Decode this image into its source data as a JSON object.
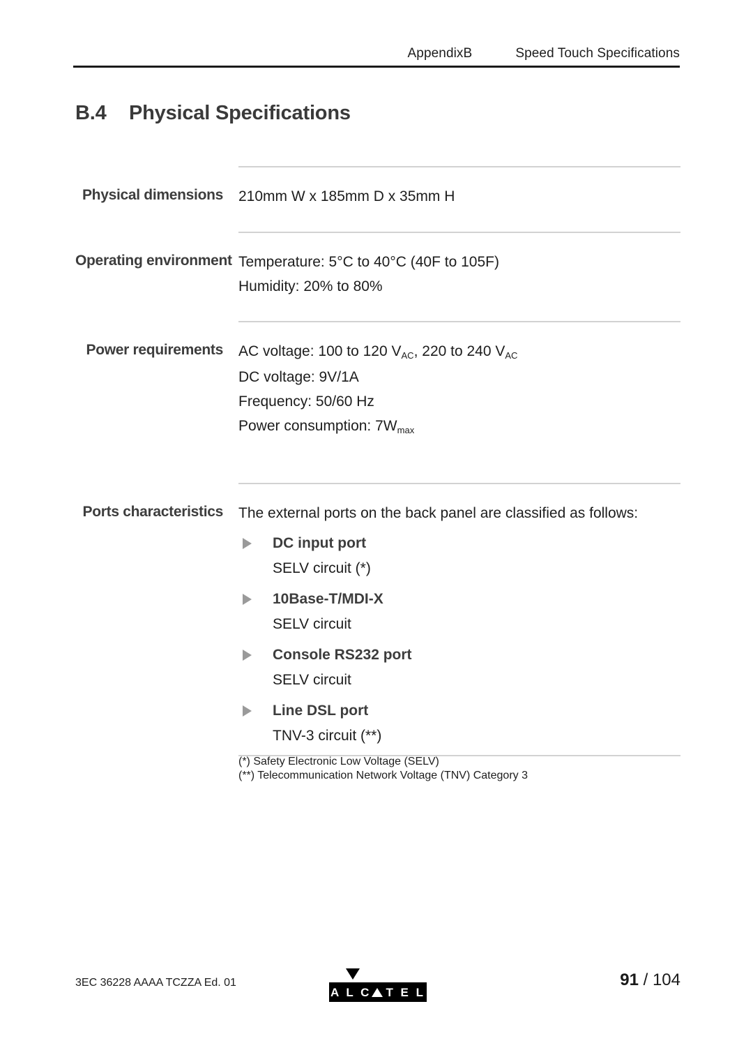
{
  "header": {
    "appendix": "AppendixB",
    "doc_title": "Speed Touch Specifications"
  },
  "section": {
    "number": "B.4",
    "title": "Physical Specifications"
  },
  "spec_table": {
    "rows": [
      {
        "label": "Physical dimensions",
        "lines": [
          "210mm W x 185mm D x 35mm H"
        ]
      },
      {
        "label": "Operating environment",
        "lines": [
          "Temperature: 5°C to 40°C (40F to 105F)",
          "Humidity: 20% to 80%"
        ]
      },
      {
        "label": "Power requirements",
        "lines": [
          "AC voltage: 100 to 120 V",
          "DC voltage: 9V/1A",
          "Frequency: 50/60 Hz",
          "Power consumption: 7W"
        ],
        "ac_sub_1": "AC",
        "ac_mid": ", 220 to 240 V",
        "ac_sub_2": "AC",
        "power_sub": "max"
      },
      {
        "label": "Ports characteristics",
        "intro": "The external ports on the back panel are classified as follows:",
        "ports": [
          {
            "name": "DC input port",
            "circuit": "SELV circuit (*)"
          },
          {
            "name": "10Base-T/MDI-X",
            "circuit": "SELV circuit"
          },
          {
            "name": "Console RS232 port",
            "circuit": "SELV circuit"
          },
          {
            "name": "Line DSL port",
            "circuit": "TNV-3 circuit (**)"
          }
        ],
        "footnotes": [
          "(*) Safety Electronic Low Voltage (SELV)",
          "(**) Telecommunication Network Voltage (TNV) Category 3"
        ]
      }
    ]
  },
  "footer": {
    "doc_code": "3EC 36228 AAAA TCZZA Ed. 01",
    "logo_text": "ALC▲TEL",
    "logo_letters_before": "A L C",
    "logo_letters_after": "T E L",
    "page_current": "91",
    "page_separator": "/",
    "page_total": "104"
  }
}
